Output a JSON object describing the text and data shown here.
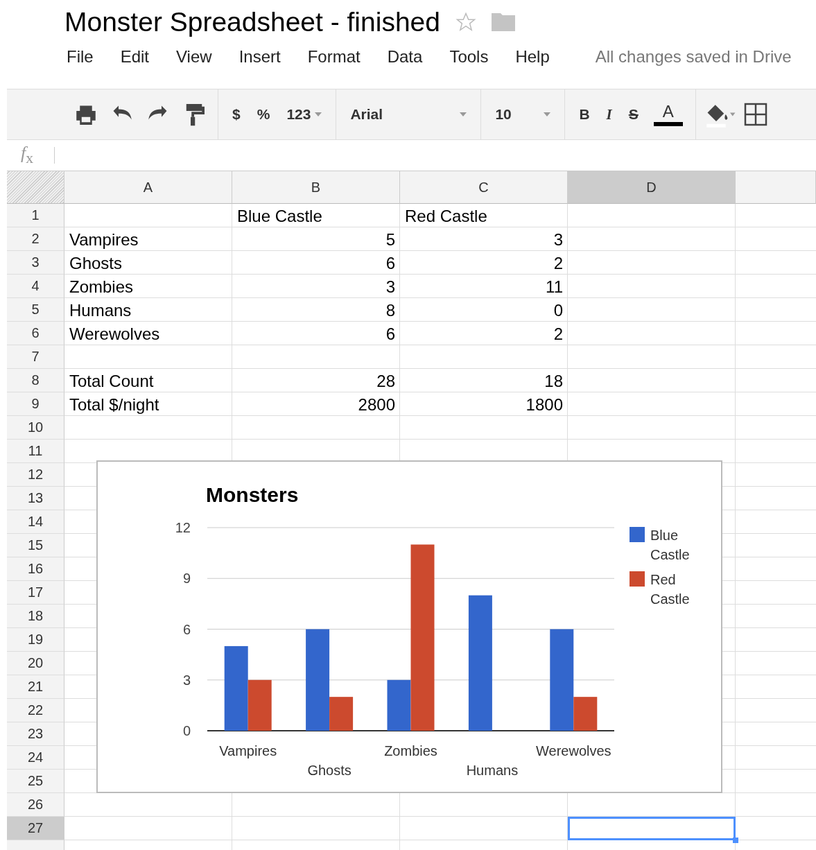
{
  "document": {
    "title": "Monster Spreadsheet - finished",
    "starred": false
  },
  "menu": [
    "File",
    "Edit",
    "View",
    "Insert",
    "Format",
    "Data",
    "Tools",
    "Help"
  ],
  "save_status": "All changes saved in Drive",
  "toolbar": [
    {
      "kind": "print"
    },
    {
      "kind": "undo"
    },
    {
      "kind": "redo"
    },
    {
      "kind": "paint"
    },
    {
      "kind": "separator"
    },
    {
      "kind": "text",
      "label": "$"
    },
    {
      "kind": "text",
      "label": "%"
    },
    {
      "kind": "dropdown",
      "label": "123"
    },
    {
      "kind": "separator"
    },
    {
      "kind": "font",
      "label": "Arial"
    },
    {
      "kind": "separator"
    },
    {
      "kind": "size",
      "label": "10"
    },
    {
      "kind": "separator"
    },
    {
      "kind": "bold",
      "label": "B"
    },
    {
      "kind": "italic",
      "label": "I"
    },
    {
      "kind": "strike",
      "label": "S"
    },
    {
      "kind": "color",
      "label": "A",
      "color": "#000000"
    },
    {
      "kind": "separator"
    },
    {
      "kind": "fill"
    },
    {
      "kind": "borders"
    }
  ],
  "formula_bar": {
    "label": "*f*$_{x}$"
  },
  "columns": [
    {
      "label": "A",
      "selected": false
    },
    {
      "label": "B",
      "selected": false
    },
    {
      "label": "C",
      "selected": false
    },
    {
      "label": "D",
      "selected": true
    }
  ],
  "rows": [
    {
      "number": "1",
      "selected": false,
      "cells": [
        null,
        {
          "value": "Blue Castle",
          "kind": "text"
        },
        {
          "value": "Red Castle",
          "kind": "text"
        }
      ]
    },
    {
      "number": "2",
      "selected": false,
      "cells": [
        {
          "value": "Vampires",
          "kind": "text"
        },
        {
          "value": "5",
          "kind": "number"
        },
        {
          "value": "3",
          "kind": "number"
        }
      ]
    },
    {
      "number": "3",
      "selected": false,
      "cells": [
        {
          "value": "Ghosts",
          "kind": "text"
        },
        {
          "value": "6",
          "kind": "number"
        },
        {
          "value": "2",
          "kind": "number"
        }
      ]
    },
    {
      "number": "4",
      "selected": false,
      "cells": [
        {
          "value": "Zombies",
          "kind": "text"
        },
        {
          "value": "3",
          "kind": "number"
        },
        {
          "value": "11",
          "kind": "number"
        }
      ]
    },
    {
      "number": "5",
      "selected": false,
      "cells": [
        {
          "value": "Humans",
          "kind": "text"
        },
        {
          "value": "8",
          "kind": "number"
        },
        {
          "value": "0",
          "kind": "number"
        }
      ]
    },
    {
      "number": "6",
      "selected": false,
      "cells": [
        {
          "value": "Werewolves",
          "kind": "text"
        },
        {
          "value": "6",
          "kind": "number"
        },
        {
          "value": "2",
          "kind": "number"
        }
      ]
    },
    {
      "number": "7",
      "selected": false
    },
    {
      "number": "8",
      "selected": false,
      "cells": [
        {
          "value": "Total Count",
          "kind": "text"
        },
        {
          "value": "28",
          "kind": "number"
        },
        {
          "value": "18",
          "kind": "number"
        }
      ]
    },
    {
      "number": "9",
      "selected": false,
      "cells": [
        {
          "value": "Total $/night",
          "kind": "text"
        },
        {
          "value": "2800",
          "kind": "number"
        },
        {
          "value": "1800",
          "kind": "number"
        }
      ]
    },
    {
      "number": "10",
      "selected": false
    },
    {
      "number": "11",
      "selected": false
    },
    {
      "number": "12",
      "selected": false
    },
    {
      "number": "13",
      "selected": false
    },
    {
      "number": "14",
      "selected": false
    },
    {
      "number": "15",
      "selected": false
    },
    {
      "number": "16",
      "selected": false
    },
    {
      "number": "17",
      "selected": false
    },
    {
      "number": "18",
      "selected": false
    },
    {
      "number": "19",
      "selected": false
    },
    {
      "number": "20",
      "selected": false
    },
    {
      "number": "21",
      "selected": false
    },
    {
      "number": "22",
      "selected": false
    },
    {
      "number": "23",
      "selected": false
    },
    {
      "number": "24",
      "selected": false
    },
    {
      "number": "25",
      "selected": false
    },
    {
      "number": "26",
      "selected": false
    },
    {
      "number": "27",
      "selected": true
    }
  ],
  "chart": {
    "chart_data": {
      "type": "bar",
      "title": "Monsters",
      "categories": [
        "Vampires",
        "Ghosts",
        "Zombies",
        "Humans",
        "Werewolves"
      ],
      "series": [
        {
          "name": "Blue Castle",
          "color": "#3366cc",
          "values": [
            5,
            6,
            3,
            8,
            6
          ]
        },
        {
          "name": "Red Castle",
          "color": "#cc4a2e",
          "values": [
            3,
            2,
            11,
            0,
            2
          ]
        }
      ],
      "ylim": [
        0,
        12
      ],
      "yticks": [
        {
          "value": 0,
          "label": "0"
        },
        {
          "value": 3,
          "label": "3"
        },
        {
          "value": 6,
          "label": "6"
        },
        {
          "value": 9,
          "label": "9"
        },
        {
          "value": 12,
          "label": "12"
        }
      ],
      "grid": true,
      "legend": true
    }
  }
}
